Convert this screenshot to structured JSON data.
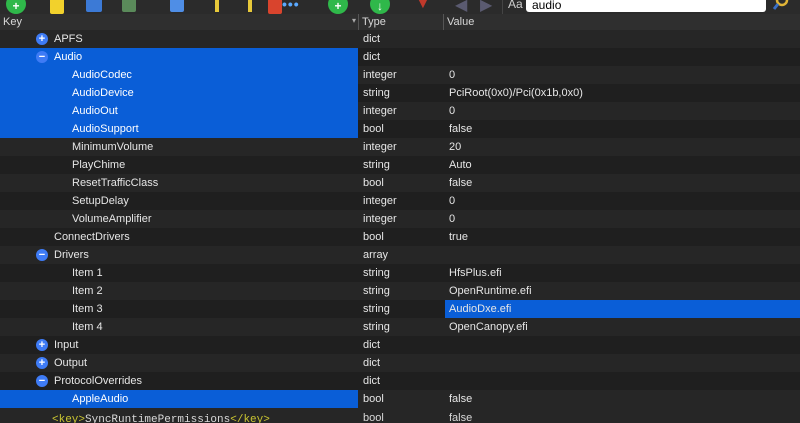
{
  "toolbar": {
    "add_glyph": "+",
    "down_glyph": "↓",
    "match_case_label": "Aa",
    "search_value": "audio",
    "colors": {
      "green": "#2fb84a",
      "blue": "#3c7ad6",
      "red": "#d9442d",
      "yellow": "#f2d12c"
    }
  },
  "header": {
    "key": "Key",
    "type": "Type",
    "value": "Value"
  },
  "rows": [
    {
      "key": "APFS",
      "type": "dict",
      "value": "",
      "disc": "+"
    },
    {
      "key": "Audio",
      "type": "dict",
      "value": "",
      "disc": "−"
    },
    {
      "key": "AudioCodec",
      "type": "integer",
      "value": "0"
    },
    {
      "key": "AudioDevice",
      "type": "string",
      "value": "PciRoot(0x0)/Pci(0x1b,0x0)"
    },
    {
      "key": "AudioOut",
      "type": "integer",
      "value": "0"
    },
    {
      "key": "AudioSupport",
      "type": "bool",
      "value": "false"
    },
    {
      "key": "MinimumVolume",
      "type": "integer",
      "value": "20"
    },
    {
      "key": "PlayChime",
      "type": "string",
      "value": "Auto"
    },
    {
      "key": "ResetTrafficClass",
      "type": "bool",
      "value": "false"
    },
    {
      "key": "SetupDelay",
      "type": "integer",
      "value": "0"
    },
    {
      "key": "VolumeAmplifier",
      "type": "integer",
      "value": "0"
    },
    {
      "key": "ConnectDrivers",
      "type": "bool",
      "value": "true"
    },
    {
      "key": "Drivers",
      "type": "array",
      "value": "",
      "disc": "−"
    },
    {
      "key": "Item 1",
      "type": "string",
      "value": "HfsPlus.efi"
    },
    {
      "key": "Item 2",
      "type": "string",
      "value": "OpenRuntime.efi"
    },
    {
      "key": "Item 3",
      "type": "string",
      "value": "AudioDxe.efi"
    },
    {
      "key": "Item 4",
      "type": "string",
      "value": "OpenCanopy.efi"
    },
    {
      "key": "Input",
      "type": "dict",
      "value": "",
      "disc": "+"
    },
    {
      "key": "Output",
      "type": "dict",
      "value": "",
      "disc": "+"
    },
    {
      "key": "ProtocolOverrides",
      "type": "dict",
      "value": "",
      "disc": "−"
    },
    {
      "key": "AppleAudio",
      "type": "bool",
      "value": "false"
    }
  ],
  "bottom": {
    "xml_open": "<key>",
    "xml_text": "SyncRuntimePermissions",
    "xml_close": "</key>",
    "type_partial": "bool",
    "value_partial": "false"
  },
  "selection_color": "#0a5ed7"
}
